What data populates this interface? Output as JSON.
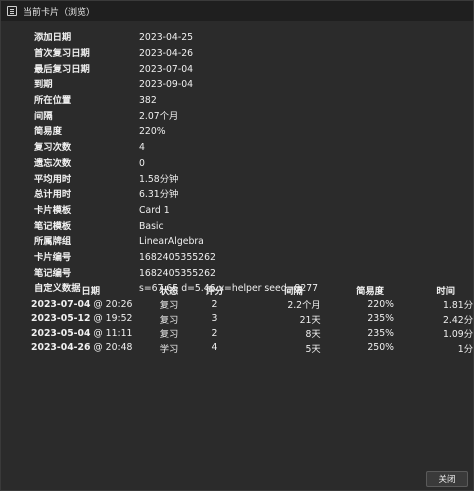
{
  "window": {
    "title": "当前卡片（浏览）"
  },
  "info": [
    {
      "label": "添加日期",
      "value": "2023-04-25"
    },
    {
      "label": "首次复习日期",
      "value": "2023-04-26"
    },
    {
      "label": "最后复习日期",
      "value": "2023-07-04"
    },
    {
      "label": "到期",
      "value": "2023-09-04"
    },
    {
      "label": "所在位置",
      "value": "382"
    },
    {
      "label": "间隔",
      "value": "2.07个月"
    },
    {
      "label": "简易度",
      "value": "220%"
    },
    {
      "label": "复习次数",
      "value": "4"
    },
    {
      "label": "遗忘次数",
      "value": "0"
    },
    {
      "label": "平均用时",
      "value": "1.58分钟"
    },
    {
      "label": "总计用时",
      "value": "6.31分钟"
    },
    {
      "label": "卡片模板",
      "value": "Card 1"
    },
    {
      "label": "笔记模板",
      "value": "Basic"
    },
    {
      "label": "所属牌组",
      "value": "LinearAlgebra"
    },
    {
      "label": "卡片编号",
      "value": "1682405355262"
    },
    {
      "label": "笔记编号",
      "value": "1682405355262"
    },
    {
      "label": "自定义数据",
      "value": "s=67.65 d=5.46 v=helper seed=8277"
    }
  ],
  "revlog": {
    "headers": {
      "date": "日期",
      "state": "状态",
      "rating": "评分",
      "interval": "间隔",
      "ease": "简易度",
      "time": "时间"
    },
    "rows": [
      {
        "date": "2023-07-04",
        "clock": " @ 20:26",
        "state": "复习",
        "state_kind": "review",
        "rating": "2",
        "interval": "2.2个月",
        "ease": "220%",
        "time": "1.81分"
      },
      {
        "date": "2023-05-12",
        "clock": " @ 19:52",
        "state": "复习",
        "state_kind": "review",
        "rating": "3",
        "interval": "21天",
        "ease": "235%",
        "time": "2.42分"
      },
      {
        "date": "2023-05-04",
        "clock": " @ 11:11",
        "state": "复习",
        "state_kind": "review",
        "rating": "2",
        "interval": "8天",
        "ease": "235%",
        "time": "1.09分"
      },
      {
        "date": "2023-04-26",
        "clock": " @ 20:48",
        "state": "学习",
        "state_kind": "learn",
        "rating": "4",
        "interval": "5天",
        "ease": "250%",
        "time": "1分"
      }
    ]
  },
  "footer": {
    "close_label": "关闭"
  }
}
